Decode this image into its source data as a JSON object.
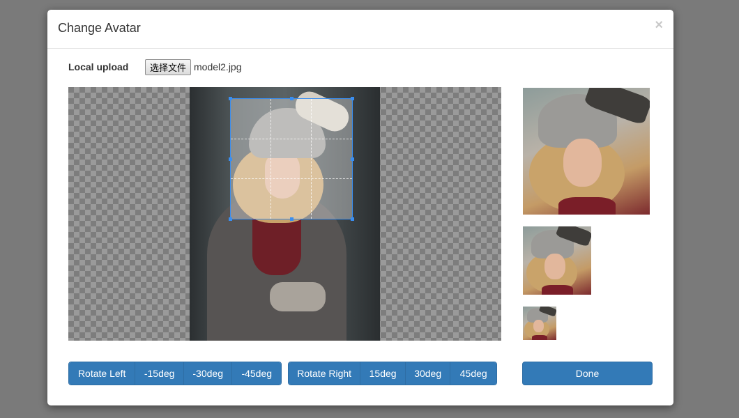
{
  "modal": {
    "title": "Change Avatar",
    "close_label": "×"
  },
  "upload": {
    "label": "Local upload",
    "choose_file_button": "选择文件",
    "file_name": "model2.jpg"
  },
  "rotate_left": {
    "label": "Rotate Left",
    "options": [
      "-15deg",
      "-30deg",
      "-45deg"
    ]
  },
  "rotate_right": {
    "label": "Rotate Right",
    "options": [
      "15deg",
      "30deg",
      "45deg"
    ]
  },
  "done_label": "Done",
  "colors": {
    "primary": "#337ab7",
    "crop_border": "#3a8ef0"
  }
}
